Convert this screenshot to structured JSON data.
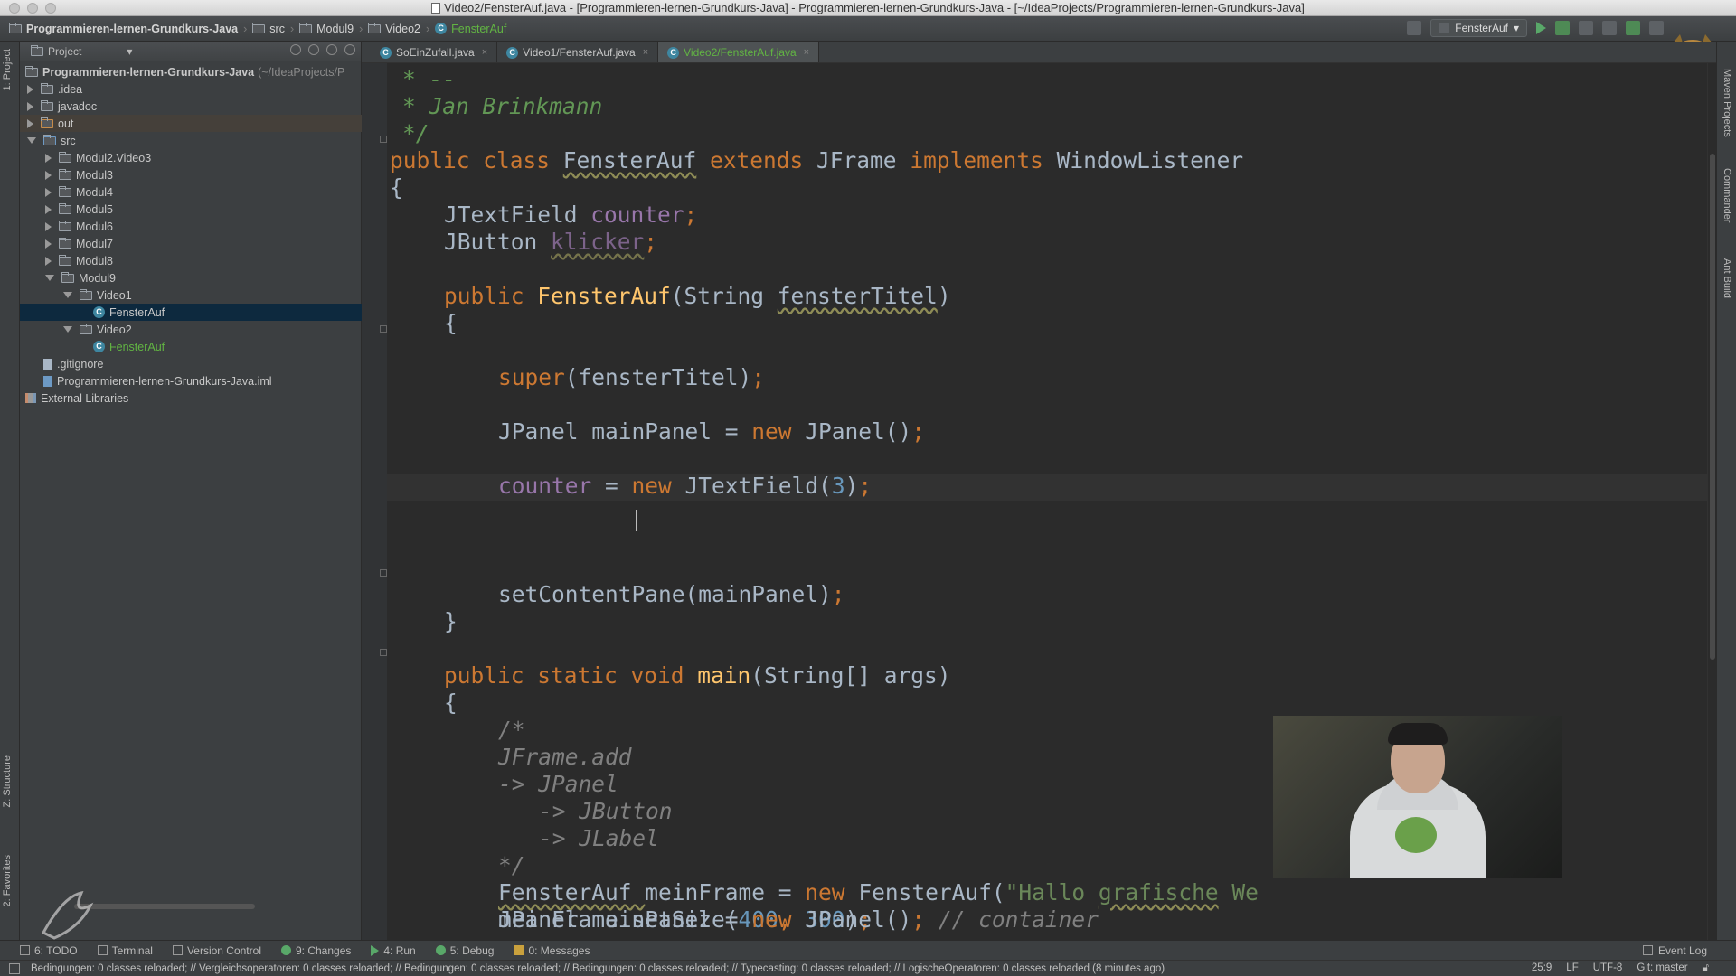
{
  "window": {
    "title": "Video2/FensterAuf.java - [Programmieren-lernen-Grundkurs-Java] - Programmieren-lernen-Grundkurs-Java - [~/IdeaProjects/Programmieren-lernen-Grundkurs-Java]"
  },
  "navbar": {
    "breadcrumbs": [
      "Programmieren-lernen-Grundkurs-Java",
      "src",
      "Modul9",
      "Video2",
      "FensterAuf"
    ],
    "run_config": "FensterAuf"
  },
  "left_strip": {
    "project_tab": "1: Project",
    "structure_tab": "Z: Structure",
    "favorites_tab": "2: Favorites"
  },
  "project_panel": {
    "header": "Project",
    "root": "Programmieren-lernen-Grundkurs-Java",
    "root_path": "(~/IdeaProjects/P",
    "items": [
      {
        "label": ".idea"
      },
      {
        "label": "javadoc"
      },
      {
        "label": "out"
      },
      {
        "label": "src"
      },
      {
        "label": "Modul2.Video3"
      },
      {
        "label": "Modul3"
      },
      {
        "label": "Modul4"
      },
      {
        "label": "Modul5"
      },
      {
        "label": "Modul6"
      },
      {
        "label": "Modul7"
      },
      {
        "label": "Modul8"
      },
      {
        "label": "Modul9"
      },
      {
        "label": "Video1"
      },
      {
        "label": "FensterAuf"
      },
      {
        "label": "Video2"
      },
      {
        "label": "FensterAuf"
      },
      {
        "label": ".gitignore"
      },
      {
        "label": "Programmieren-lernen-Grundkurs-Java.iml"
      },
      {
        "label": "External Libraries"
      }
    ]
  },
  "tabs": [
    {
      "label": "SoEinZufall.java"
    },
    {
      "label": "Video1/FensterAuf.java"
    },
    {
      "label": "Video2/FensterAuf.java"
    }
  ],
  "code": {
    "l1": "* --",
    "l2": "* Jan Brinkmann",
    "l3": "*/",
    "l4_a": "public class ",
    "l4_b": "FensterAuf",
    "l4_c": " extends ",
    "l4_d": "JFrame",
    "l4_e": " implements ",
    "l4_f": "WindowListener",
    "l5": "{",
    "l6_a": "JTextField ",
    "l6_b": "counter",
    "l6_c": ";",
    "l7_a": "JButton ",
    "l7_b": "klicker",
    "l7_c": ";",
    "l8_a": "public ",
    "l8_b": "FensterAuf",
    "l8_c": "(String ",
    "l8_d": "fensterTitel",
    "l8_e": ")",
    "l9": "{",
    "l10_a": "super",
    "l10_b": "(fensterTitel)",
    "l10_c": ";",
    "l11_a": "JPanel mainPanel = ",
    "l11_b": "new ",
    "l11_c": "JPanel()",
    "l11_d": ";",
    "l12_a": "counter",
    "l12_b": " = ",
    "l12_c": "new ",
    "l12_d": "JTextField(",
    "l12_e": "3",
    "l12_f": ")",
    "l12_g": ";",
    "l13_a": "setContentPane(mainPanel)",
    "l13_b": ";",
    "l14": "}",
    "l15_a": "public static void ",
    "l15_b": "main",
    "l15_c": "(String[] args)",
    "l16": "{",
    "l17": "/*",
    "l18": "JFrame.add",
    "l19": "-> JPanel",
    "l20": "-> JButton",
    "l21": "-> JLabel",
    "l22": "*/",
    "l23_a": "FensterAuf ",
    "l23_b": "meinFrame",
    "l23_c": " = ",
    "l23_d": "new ",
    "l23_e": "FensterAuf(",
    "l23_f": "\"Hallo ",
    "l23_g": "grafische",
    "l23_h": " We",
    "l24_a": "meinFrame.setSize(",
    "l24_b": "400",
    "l24_c": ", ",
    "l24_d": "300",
    "l24_e": ")",
    "l24_f": ";",
    "l25_a": "JPanel mainPanel = ",
    "l25_b": "new ",
    "l25_c": "JPanel()",
    "l25_d": "; ",
    "l25_e": "// container"
  },
  "right_strip": {
    "maven": "Maven Projects",
    "commander": "Commander",
    "ant": "Ant Build"
  },
  "bottom_tools": [
    {
      "label": "6: TODO"
    },
    {
      "label": "Terminal"
    },
    {
      "label": "Version Control"
    },
    {
      "label": "9: Changes"
    },
    {
      "label": "4: Run"
    },
    {
      "label": "5: Debug"
    },
    {
      "label": "0: Messages"
    }
  ],
  "event_log": "Event Log",
  "status": {
    "message": "Bedingungen: 0 classes reloaded; // Vergleichsoperatoren: 0 classes reloaded; // Bedingungen: 0 classes reloaded; // Bedingungen: 0 classes reloaded; // Typecasting: 0 classes reloaded; // LogischeOperatoren: 0 classes reloaded (8 minutes ago)",
    "position": "25:9",
    "line_sep": "LF",
    "encoding": "UTF-8",
    "vcs": "Git: master"
  }
}
